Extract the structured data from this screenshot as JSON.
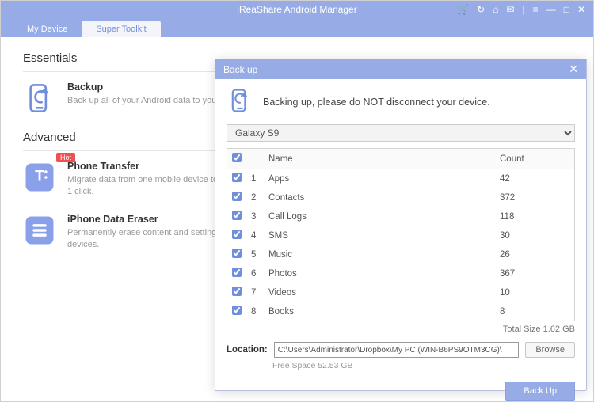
{
  "app": {
    "title": "iReaShare Android Manager"
  },
  "tabs": {
    "device": "My Device",
    "toolkit": "Super Toolkit"
  },
  "sections": {
    "essentials": "Essentials",
    "advanced": "Advanced"
  },
  "items": {
    "backup": {
      "label": "Backup",
      "desc": "Back up all of your Android data to your PC."
    },
    "transfer": {
      "hot": "Hot",
      "label": "Phone Transfer",
      "desc": "Migrate data from one mobile device to another in 1 click."
    },
    "eraser": {
      "label": "iPhone Data Eraser",
      "desc": "Permanently erase content and settings on iOS devices."
    }
  },
  "modal": {
    "title": "Back up",
    "message": "Backing up, please do NOT disconnect your device.",
    "device": "Galaxy S9",
    "headers": {
      "name": "Name",
      "count": "Count"
    },
    "rows": [
      {
        "idx": "1",
        "name": "Apps",
        "count": "42"
      },
      {
        "idx": "2",
        "name": "Contacts",
        "count": "372"
      },
      {
        "idx": "3",
        "name": "Call Logs",
        "count": "118"
      },
      {
        "idx": "4",
        "name": "SMS",
        "count": "30"
      },
      {
        "idx": "5",
        "name": "Music",
        "count": "26"
      },
      {
        "idx": "6",
        "name": "Photos",
        "count": "367"
      },
      {
        "idx": "7",
        "name": "Videos",
        "count": "10"
      },
      {
        "idx": "8",
        "name": "Books",
        "count": "8"
      }
    ],
    "total": "Total Size 1.62 GB",
    "locationLabel": "Location:",
    "locationPath": "C:\\Users\\Administrator\\Dropbox\\My PC (WIN-B6PS9OTM3CG)\\",
    "browse": "Browse",
    "freespace": "Free Space 52.53 GB",
    "backup": "Back Up"
  }
}
